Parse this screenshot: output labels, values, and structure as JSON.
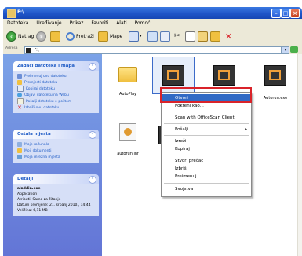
{
  "window": {
    "title": "F:\\"
  },
  "menubar": [
    "Datoteka",
    "Uređivanje",
    "Prikaz",
    "Favoriti",
    "Alati",
    "Pomoć"
  ],
  "toolbar": {
    "back_label": "Natrag",
    "search_label": "Pretraži",
    "folders_label": "Mape"
  },
  "address": {
    "label": "Adresa",
    "value": "F:\\"
  },
  "left_pane": {
    "tasks": {
      "title": "Zadaci datoteka i mapa",
      "items": [
        "Preimenuj ovu datoteku",
        "Premjesti datoteku",
        "Kopiraj datoteku",
        "Objavi datoteku na Webu",
        "Pošalji datoteku e-poštom",
        "Izbriši ovu datoteku"
      ]
    },
    "other_places": {
      "title": "Ostala mjesta",
      "items": [
        "Moje računalo",
        "Moji dokumenti",
        "Moja mrežna mjesta"
      ]
    },
    "details": {
      "title": "Detalji",
      "filename": "aladdin.exe",
      "type": "Application",
      "attributes": "Atributi: Samo za čitanje",
      "modified": "Datum promjene: 21. srpanj 2010., 14:44",
      "size": "Veličina: 6,11 MB"
    }
  },
  "files": [
    {
      "name": "AutoPlay",
      "icon": "folder-icon"
    },
    {
      "name": "",
      "icon": "app-icon"
    },
    {
      "name": "",
      "icon": "app-icon"
    },
    {
      "name": "Autorun.exe",
      "icon": "app-icon"
    },
    {
      "name": "autorun.inf",
      "icon": "settings-file-icon"
    },
    {
      "name": "",
      "icon": "app-icon"
    }
  ],
  "context_menu": {
    "items": [
      "Otvori",
      "Pokreni kao...",
      "Scan with OfficeScan Client",
      "Pošalji",
      "Izreži",
      "Kopiraj",
      "Stvori prečac",
      "Izbriši",
      "Preimenuj",
      "Svojstva"
    ],
    "submenu_arrow": "▸"
  },
  "colors": {
    "titlebar": "#1f55c8",
    "highlight": "#316ac5",
    "callout": "#d9232a"
  }
}
